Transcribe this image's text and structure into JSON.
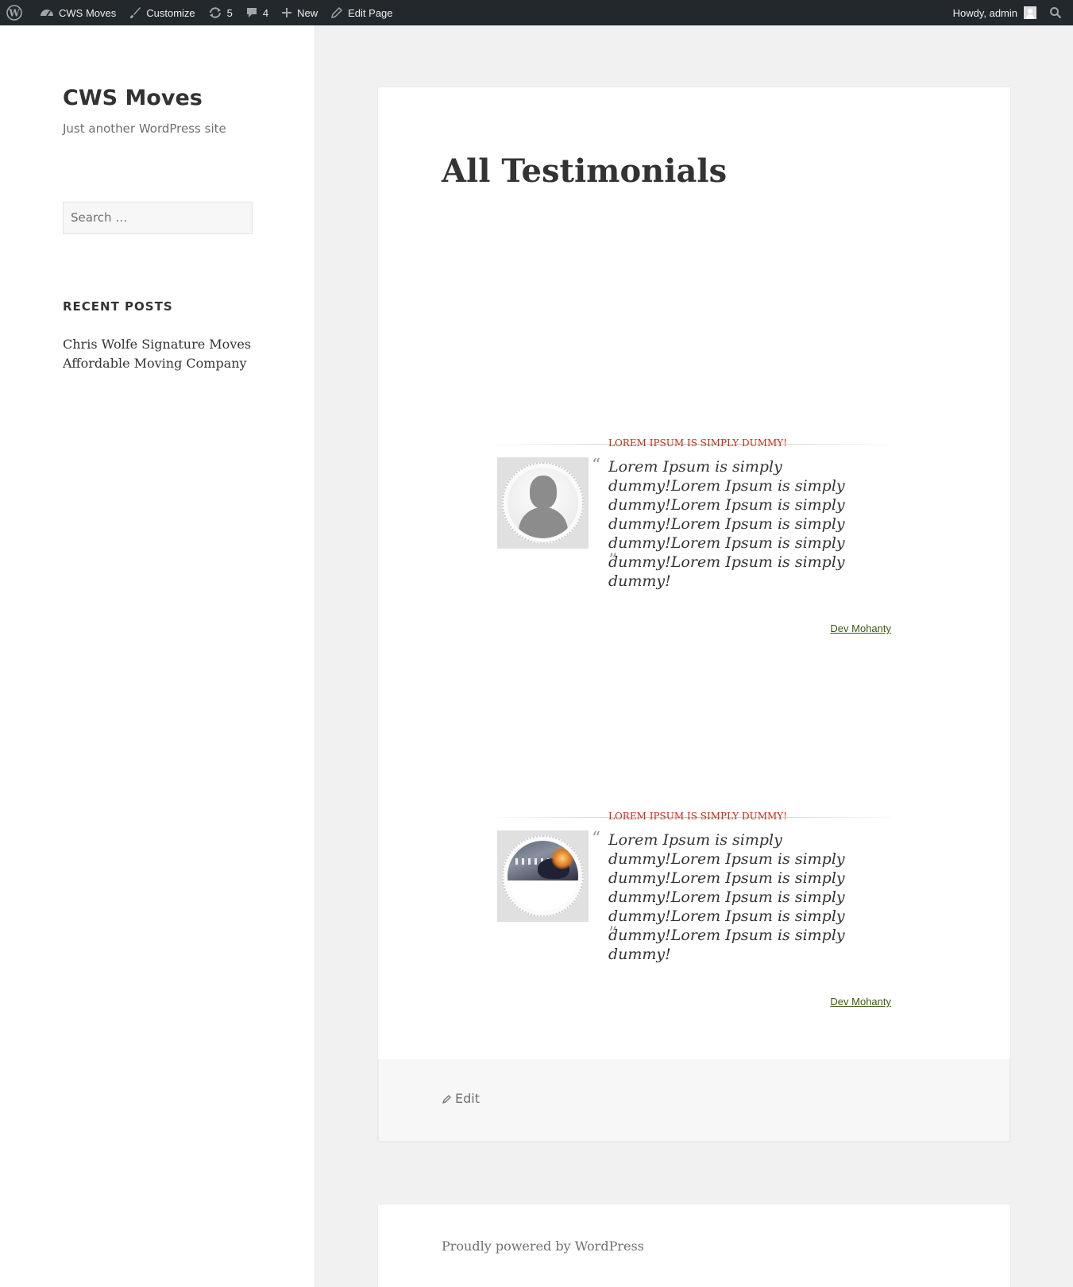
{
  "adminbar": {
    "site_name": "CWS Moves",
    "customize": "Customize",
    "updates_count": "5",
    "comments_count": "4",
    "new_label": "New",
    "edit_page": "Edit Page",
    "howdy": "Howdy, admin"
  },
  "sidebar": {
    "site_title": "CWS Moves",
    "site_description": "Just another WordPress site",
    "search_placeholder": "Search …",
    "recent_posts_title": "RECENT POSTS",
    "recent_posts": [
      "Chris Wolfe Signature Moves",
      "Affordable Moving Company"
    ]
  },
  "main": {
    "page_title": "All Testimonials",
    "testimonials": [
      {
        "heading": "LOREM IPSUM IS SIMPLY DUMMY!",
        "quote": "Lorem Ipsum is simply dummy!Lorem Ipsum is simply dummy!Lorem Ipsum is simply dummy!Lorem Ipsum is simply dummy!Lorem Ipsum is simply dummy!Lorem Ipsum is simply dummy!",
        "author": "Dev Mohanty",
        "photo": "default-avatar"
      },
      {
        "heading": "LOREM IPSUM IS SIMPLY DUMMY!",
        "quote": "Lorem Ipsum is simply dummy!Lorem Ipsum is simply dummy!Lorem Ipsum is simply dummy!Lorem Ipsum is simply dummy!Lorem Ipsum is simply dummy!Lorem Ipsum is simply dummy!",
        "author": "Dev Mohanty",
        "photo": "chess-fire-image"
      }
    ],
    "quote_open": "“",
    "quote_close": "”",
    "edit_label": "Edit"
  },
  "footer": {
    "powered_by": "Proudly powered by WordPress"
  },
  "colors": {
    "adminbar_bg": "#23282d",
    "accent_red": "#c42d16",
    "author_link": "#3a5a10"
  }
}
